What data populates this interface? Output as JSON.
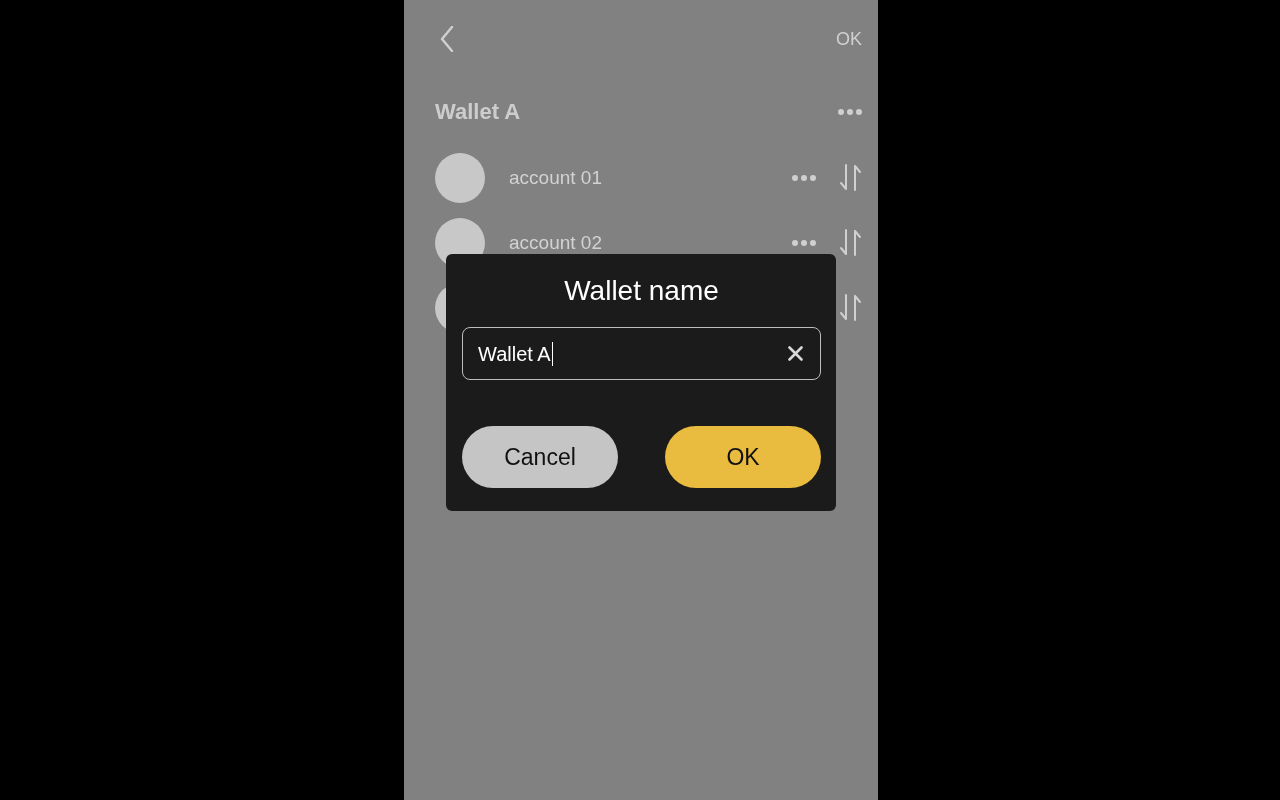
{
  "top_bar": {
    "action": "OK"
  },
  "wallet": {
    "name": "Wallet A"
  },
  "accounts": [
    {
      "name": "account 01",
      "sortable": true
    },
    {
      "name": "account 02",
      "sortable": true
    },
    {
      "sortable": true
    }
  ],
  "dialog": {
    "title": "Wallet name",
    "input": {
      "value": "Wallet A",
      "focused": true
    },
    "buttons": [
      {
        "label": "Cancel",
        "kind": "secondary"
      },
      {
        "label": "OK",
        "kind": "primary"
      }
    ]
  }
}
